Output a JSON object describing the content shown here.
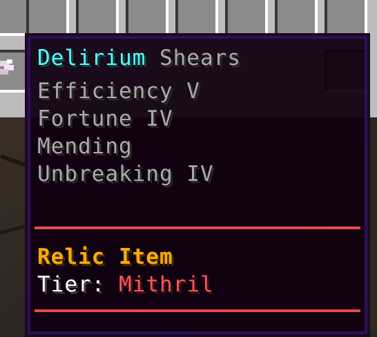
{
  "tooltip": {
    "item_name_prefix": "Delirium",
    "item_name_suffix": "Shears",
    "enchantments": [
      "Efficiency V",
      "Fortune IV",
      "Mending",
      "Unbreaking IV"
    ],
    "rarity_label": "Relic Item",
    "tier_label": "Tier:",
    "tier_value": "Mithril"
  },
  "colors": {
    "name_prefix": "#55ffff",
    "enchant_text": "#aaaaaa",
    "rarity": "#ffaa00",
    "tier_value": "#ff5555",
    "divider": "#e44a4a",
    "tooltip_border": "#2e0f5a"
  },
  "icons": {
    "held_item": "shears-icon"
  }
}
